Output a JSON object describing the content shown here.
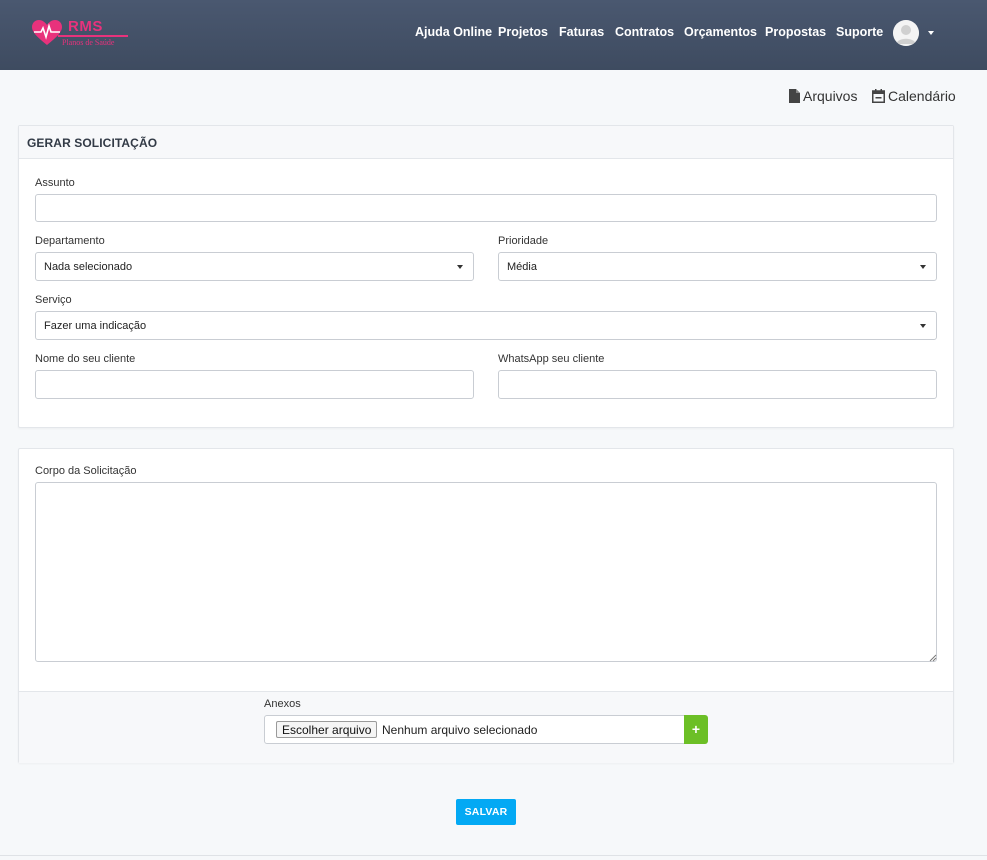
{
  "brand": {
    "name": "RMS",
    "tagline": "Planos de Saúde",
    "color": "#e8327c"
  },
  "nav": {
    "items": [
      {
        "label": "Ajuda Online"
      },
      {
        "label": "Projetos"
      },
      {
        "label": "Faturas"
      },
      {
        "label": "Contratos"
      },
      {
        "label": "Orçamentos"
      },
      {
        "label": "Propostas"
      },
      {
        "label": "Suporte"
      }
    ]
  },
  "toplinks": {
    "files": "Arquivos",
    "calendar": "Calendário"
  },
  "form": {
    "title": "GERAR SOLICITAÇÃO",
    "subject_label": "Assunto",
    "subject_value": "",
    "department_label": "Departamento",
    "department_value": "Nada selecionado",
    "priority_label": "Prioridade",
    "priority_value": "Média",
    "service_label": "Serviço",
    "service_value": "Fazer uma indicação",
    "client_name_label": "Nome do seu cliente",
    "client_name_value": "",
    "client_whatsapp_label": "WhatsApp seu cliente",
    "client_whatsapp_value": ""
  },
  "body": {
    "label": "Corpo da Solicitação",
    "value": "",
    "attachments_label": "Anexos",
    "choose_file": "Escolher arquivo",
    "no_file": "Nenhum arquivo selecionado",
    "add_symbol": "+"
  },
  "actions": {
    "save": "SALVAR"
  },
  "colors": {
    "header": "#44526a",
    "save_button": "#03a9f4",
    "add_button": "#6cbf26"
  }
}
